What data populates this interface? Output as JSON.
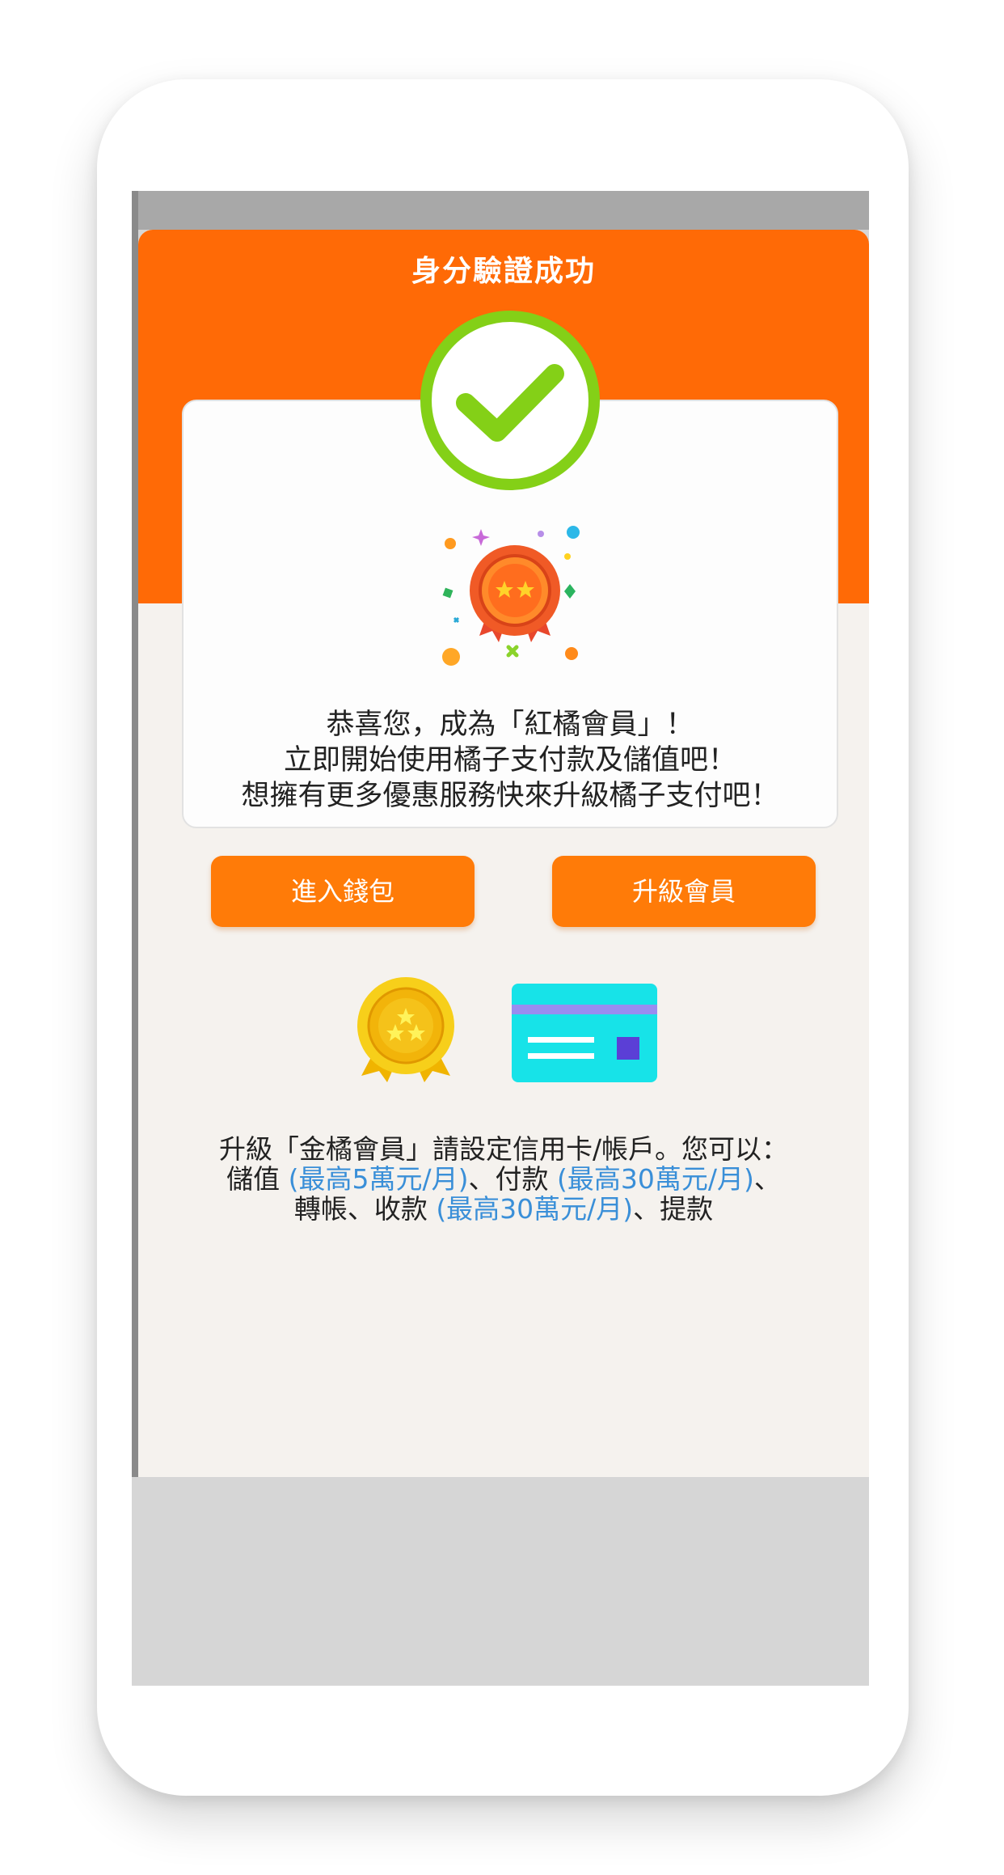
{
  "header": {
    "title": "身分驗證成功"
  },
  "card": {
    "lines": [
      "恭喜您，成為「紅橘會員」！",
      "立即開始使用橘子支付款及儲值吧！",
      "想擁有更多優惠服務快來升級橘子支付吧！"
    ]
  },
  "buttons": {
    "wallet_label": "進入錢包",
    "upgrade_label": "升級會員"
  },
  "info": {
    "line1": "升級「金橘會員」請設定信用卡/帳戶。您可以：",
    "line2_a": "儲值 ",
    "line2_b": "(最高5萬元/月)",
    "line2_c": "、付款 ",
    "line2_d": "(最高30萬元/月)",
    "line2_e": "、",
    "line3_a": "轉帳、收款 ",
    "line3_b": "(最高30萬元/月)",
    "line3_c": "、提款"
  },
  "icons": {
    "check": "check-circle-icon",
    "medal": "medal-icon",
    "gold_medal": "gold-medal-icon",
    "card": "credit-card-icon"
  },
  "colors": {
    "brand_orange": "#ff6a06",
    "button_orange": "#ff7b08",
    "check_green": "#7ed321",
    "link_blue": "#3a8fd8",
    "background": "#f5f2ee",
    "card_cyan": "#17e0e6"
  }
}
